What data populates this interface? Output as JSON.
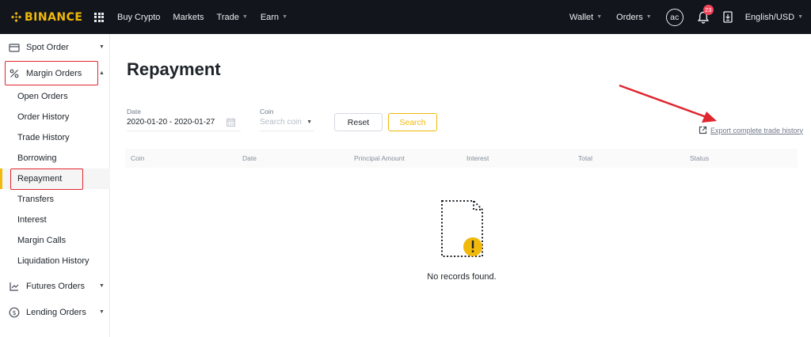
{
  "header": {
    "logo_text": "BINANCE",
    "nav": [
      {
        "label": "Buy Crypto",
        "caret": false
      },
      {
        "label": "Markets",
        "caret": false
      },
      {
        "label": "Trade",
        "caret": true
      },
      {
        "label": "Earn",
        "caret": true
      }
    ],
    "wallet_label": "Wallet",
    "orders_label": "Orders",
    "avatar_text": "ac",
    "notification_count": "23",
    "language_label": "English/USD",
    "brand_color": "#f0b90b"
  },
  "sidebar": {
    "groups": {
      "spot": {
        "label": "Spot Order",
        "icon": "card-icon"
      },
      "margin": {
        "label": "Margin Orders",
        "icon": "percent-icon"
      },
      "futures": {
        "label": "Futures Orders",
        "icon": "futures-icon"
      },
      "lending": {
        "label": "Lending Orders",
        "icon": "dollar-coin-icon"
      }
    },
    "margin_items": [
      "Open Orders",
      "Order History",
      "Trade History",
      "Borrowing",
      "Repayment",
      "Transfers",
      "Interest",
      "Margin Calls",
      "Liquidation History"
    ],
    "active_item": "Repayment"
  },
  "main": {
    "title": "Repayment",
    "filters": {
      "date_label": "Date",
      "date_value": "2020-01-20 - 2020-01-27",
      "coin_label": "Coin",
      "coin_placeholder": "Search coin",
      "reset_label": "Reset",
      "search_label": "Search"
    },
    "export_label": "Export complete trade history",
    "table_headers": [
      "Coin",
      "Date",
      "Principal Amount",
      "Interest",
      "Total",
      "Status"
    ],
    "empty_text": "No records found."
  }
}
